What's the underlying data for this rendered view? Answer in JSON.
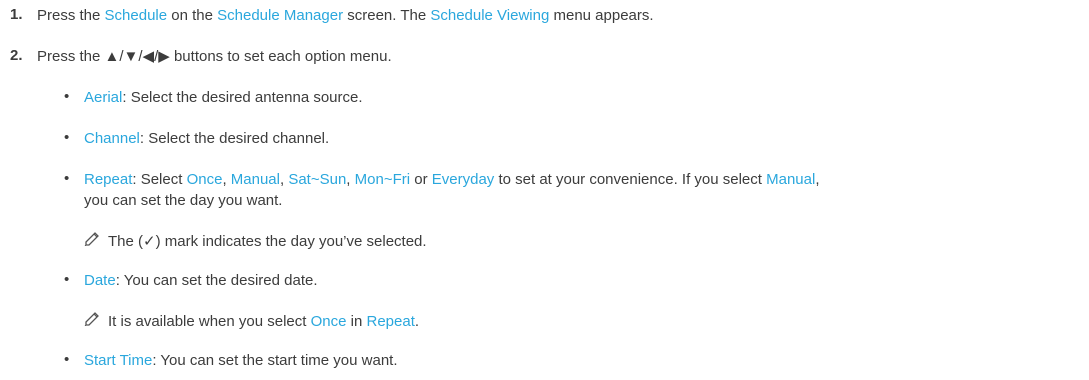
{
  "steps": [
    {
      "number": "1.",
      "parts": [
        {
          "t": "Press the ",
          "hl": false
        },
        {
          "t": "Schedule",
          "hl": true
        },
        {
          "t": " on the ",
          "hl": false
        },
        {
          "t": "Schedule Manager",
          "hl": true
        },
        {
          "t": " screen. The ",
          "hl": false
        },
        {
          "t": "Schedule Viewing",
          "hl": true
        },
        {
          "t": " menu appears.",
          "hl": false
        }
      ]
    },
    {
      "number": "2.",
      "parts": [
        {
          "t": "Press the ▲/▼/◀/▶ buttons to set each option menu.",
          "hl": false
        }
      ]
    }
  ],
  "bullets": {
    "aerial": {
      "term": "Aerial",
      "text": ": Select the desired antenna source."
    },
    "channel": {
      "term": "Channel",
      "text": ": Select the desired channel."
    },
    "repeat": {
      "term": "Repeat",
      "t1": ": Select ",
      "once": "Once",
      "sep1": ", ",
      "manual": "Manual",
      "sep2": ", ",
      "satsun": "Sat~Sun",
      "sep3": ", ",
      "monfri": "Mon~Fri",
      "sep4": " or ",
      "everyday": "Everyday",
      "t2": " to set at your convenience. If you select ",
      "manual2": "Manual",
      "t3": ",",
      "line2": "you can set the day you want."
    },
    "repeat_note": {
      "pre": "The (",
      "check": "✓",
      "post": ") mark indicates the day you’ve selected."
    },
    "date": {
      "term": "Date",
      "text": ": You can set the desired date."
    },
    "date_note": {
      "pre": "It is available when you select ",
      "once": "Once",
      "mid": " in ",
      "repeat": "Repeat",
      "post": "."
    },
    "start_time": {
      "term": "Start Time",
      "text": ": You can set the start time you want."
    }
  },
  "colors": {
    "accent": "#2aa7dd",
    "text": "#3c3c3c"
  },
  "icons": {
    "note": "pencil-note-icon",
    "bullet": "bullet-dot-icon"
  }
}
